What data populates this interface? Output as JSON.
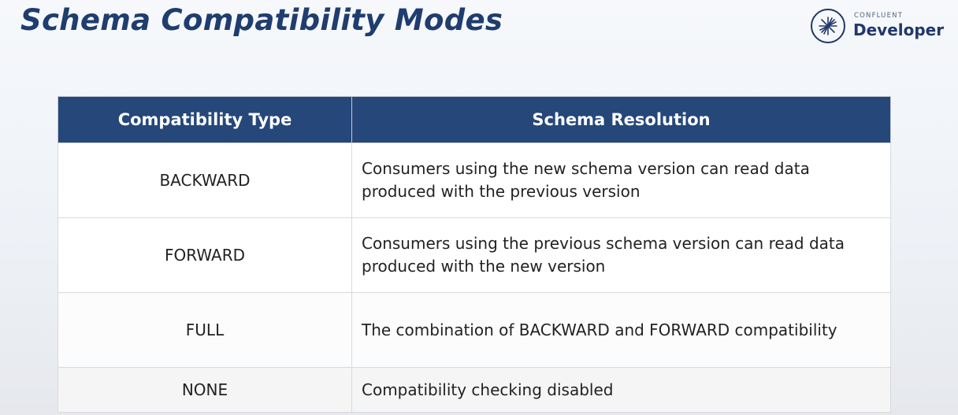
{
  "slide": {
    "title": "Schema Compatibility Modes"
  },
  "logo": {
    "small_text": "CONFLUENT",
    "big_text": "Developer",
    "icon": "confluent-starburst-icon",
    "color": "#21386b"
  },
  "table": {
    "header_color": "#25477a",
    "headers": [
      "Compatibility Type",
      "Schema Resolution"
    ],
    "rows": [
      {
        "type": "BACKWARD",
        "resolution": "Consumers using the new schema version can read data produced with the previous version"
      },
      {
        "type": "FORWARD",
        "resolution": "Consumers using the previous schema version can read data produced with the new version"
      },
      {
        "type": "FULL",
        "resolution": "The combination of BACKWARD and FORWARD compatibility"
      },
      {
        "type": "NONE",
        "resolution": "Compatibility checking disabled"
      }
    ]
  }
}
